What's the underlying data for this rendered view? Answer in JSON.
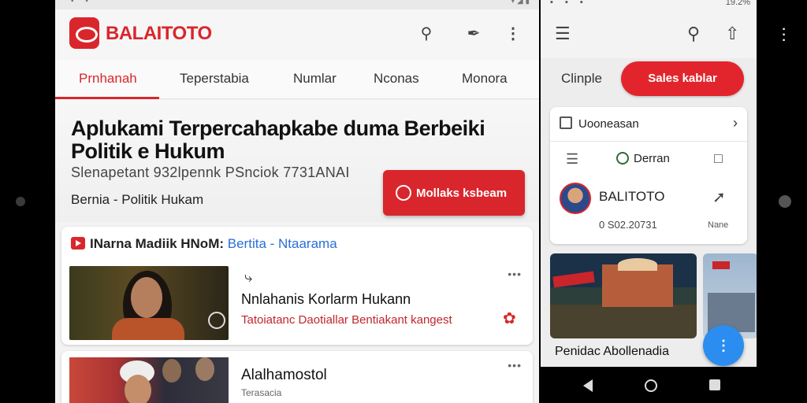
{
  "colors": {
    "brand_red": "#d9262c",
    "accent_blue": "#2c8df0",
    "link_blue": "#2a6fd6"
  },
  "left": {
    "status_time": "",
    "brand": "BALAITOTO",
    "icons": [
      "search-icon",
      "tag-icon",
      "more-vert-icon"
    ],
    "tabs": [
      {
        "label": "Prnhanah",
        "active": true
      },
      {
        "label": "Teperstabia"
      },
      {
        "label": "Numlar"
      },
      {
        "label": "Nconas"
      },
      {
        "label": "Monora"
      }
    ],
    "hero": {
      "title": "Aplukami Terpercahapkabe duma Berbeiki Politik e Hukum",
      "subtitle": "Slenapetant 932lpennk PSnciok 7731ANAI",
      "category": "Bernia - Politik Hukam",
      "button_label": "Mollaks ksbeam"
    },
    "card": {
      "heading": "INarna Madiik HNoM:",
      "heading_link": "Bertita - Ntaarama",
      "share_icon": "share-icon",
      "story_title": "Nnlahanis Korlarm Hukann",
      "story_meta": "Tatoiatanc Daotiallar Bentiakant kangest",
      "more": "•••"
    },
    "card2": {
      "title": "Alalhamostol",
      "subtitle": "Terasacia",
      "more": "•••"
    }
  },
  "right": {
    "status": "19.2%",
    "chip_simple": "Clinple",
    "chip_red": "Sales kablar",
    "panel": {
      "row1": "Uooneasan",
      "row2_label": "Derran",
      "name": "BALITOTO",
      "number": "0 S02.20731",
      "note": "Nane"
    },
    "caption": "Penidac Abollenadia"
  }
}
